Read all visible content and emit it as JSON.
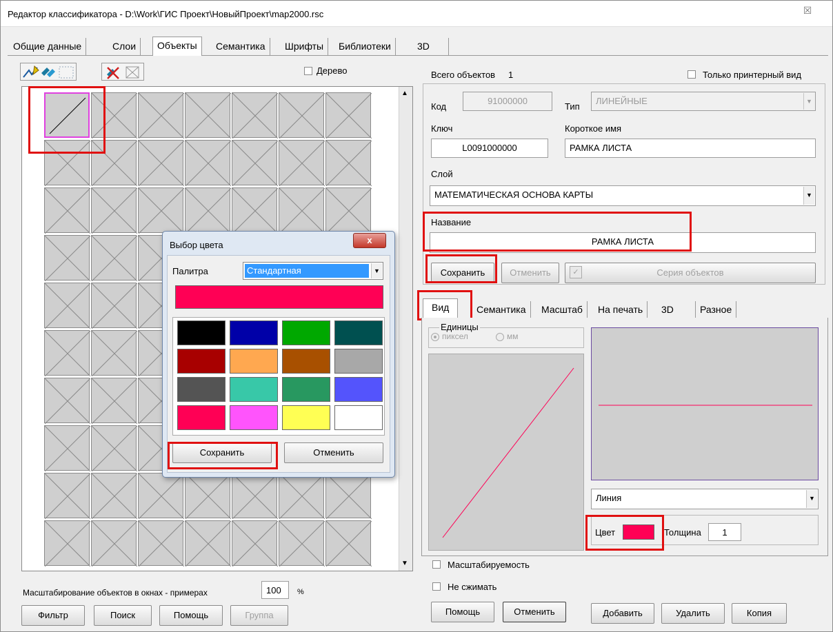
{
  "window": {
    "title": "Редактор классификатора - D:\\Work\\ГИС Проект\\НовыйПроект\\map2000.rsc",
    "close_glyph": "☒"
  },
  "main_tabs": [
    "Общие данные",
    "Слои",
    "Объекты",
    "Семантика",
    "Шрифты",
    "Библиотеки",
    "3D"
  ],
  "left": {
    "tree_label": "Дерево",
    "scale_label": "Масштабирование объектов в окнах - примерах",
    "scale_value": "100",
    "scale_unit": "%",
    "buttons": {
      "filter": "Фильтр",
      "search": "Поиск",
      "help": "Помощь",
      "group": "Группа"
    }
  },
  "right": {
    "total_label": "Всего объектов",
    "total_value": "1",
    "printer_only_label": "Только принтерный вид",
    "code_label": "Код",
    "code_value": "91000000",
    "type_label": "Тип",
    "type_value": "ЛИНЕЙНЫЕ",
    "key_label": "Ключ",
    "key_value": "L0091000000",
    "short_name_label": "Короткое имя",
    "short_name_value": "РАМКА ЛИСТА",
    "layer_label": "Слой",
    "layer_value": "МАТЕМАТИЧЕСКАЯ ОСНОВА КАРТЫ",
    "name_label": "Название",
    "name_value": "РАМКА ЛИСТА",
    "save": "Сохранить",
    "cancel": "Отменить",
    "series": "Серия объектов"
  },
  "sub_tabs": [
    "Вид",
    "Семантика",
    "Масштаб",
    "На печать",
    "3D",
    "Разное"
  ],
  "view": {
    "units_label": "Единицы",
    "units_pixel": "пиксел",
    "units_mm": "мм",
    "primitive_value": "Линия",
    "color_label": "Цвет",
    "thickness_label": "Толщина",
    "thickness_value": "1",
    "scalable_label": "Масштабируемость",
    "no_shrink_label": "Не сжимать",
    "line_color": "#ff0055"
  },
  "bottom_buttons": {
    "help": "Помощь",
    "cancel": "Отменить",
    "add": "Добавить",
    "delete": "Удалить",
    "copy": "Копия"
  },
  "color_dialog": {
    "title": "Выбор цвета",
    "close_glyph": "x",
    "palette_label": "Палитра",
    "palette_value": "Стандартная",
    "current_color": "#ff0055",
    "colors": [
      "#000000",
      "#0000a8",
      "#00a800",
      "#005050",
      "#a80000",
      "#ffa850",
      "#a85000",
      "#a8a8a8",
      "#545454",
      "#38c8a8",
      "#289860",
      "#5454fc",
      "#ff0055",
      "#ff54fc",
      "#ffff54",
      "#ffffff"
    ],
    "save": "Сохранить",
    "cancel": "Отменить"
  },
  "accent_highlight": "#e01010"
}
